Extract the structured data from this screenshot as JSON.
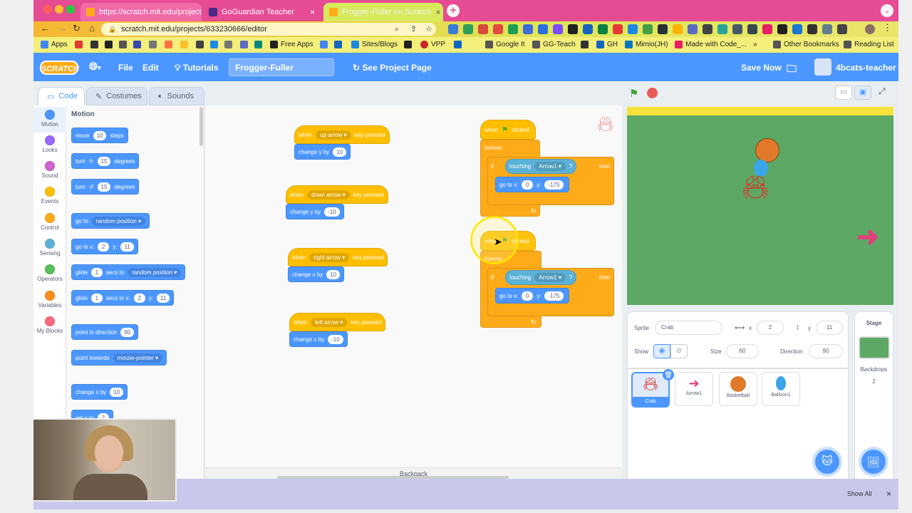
{
  "browser": {
    "tabs": [
      {
        "label": "https://scratch.mit.edu/projects",
        "close": "×"
      },
      {
        "label": "GoGuardian Teacher",
        "close": "×"
      },
      {
        "label": "Frogger-Fuller on Scratch",
        "close": "×"
      }
    ],
    "url": "scratch.mit.edu/projects/633230666/editor",
    "bookmarks": [
      "Apps",
      "Free Apps",
      "Sites/Blogs",
      "VPP",
      "Google It",
      "GG-Teach",
      "GH",
      "Mimio(JH)",
      "Made with Code_...",
      "Other Bookmarks",
      "Reading List"
    ]
  },
  "menubar": {
    "logo": "SCRATCH",
    "file": "File",
    "edit": "Edit",
    "tutorials": "Tutorials",
    "project_title": "Frogger-Fuller",
    "see_project": "See Project Page",
    "save": "Save Now",
    "username": "4bcats-teacher"
  },
  "editor_tabs": {
    "code": "Code",
    "costumes": "Costumes",
    "sounds": "Sounds"
  },
  "categories": [
    {
      "label": "Motion",
      "color": "#4c97ff"
    },
    {
      "label": "Looks",
      "color": "#9966ff"
    },
    {
      "label": "Sound",
      "color": "#cf63cf"
    },
    {
      "label": "Events",
      "color": "#ffbf00"
    },
    {
      "label": "Control",
      "color": "#ffab19"
    },
    {
      "label": "Sensing",
      "color": "#5cb1d6"
    },
    {
      "label": "Operators",
      "color": "#59c059"
    },
    {
      "label": "Variables",
      "color": "#ff8c1a"
    },
    {
      "label": "My Blocks",
      "color": "#ff6680"
    }
  ],
  "palette": {
    "heading": "Motion",
    "move": {
      "label": "move",
      "value": "10",
      "suffix": "steps"
    },
    "turn_right": {
      "label": "turn",
      "value": "15",
      "suffix": "degrees"
    },
    "turn_left": {
      "label": "turn",
      "value": "15",
      "suffix": "degrees"
    },
    "goto": {
      "label": "go to",
      "option": "random position"
    },
    "goto_xy": {
      "label": "go to x:",
      "x": "2",
      "ylabel": "y:",
      "y": "11"
    },
    "glide_random": {
      "label": "glide",
      "value": "1",
      "mid": "secs to",
      "option": "random position"
    },
    "glide_xy": {
      "label": "glide",
      "value": "1",
      "mid": "secs to x:",
      "x": "2",
      "ylabel": "y:",
      "y": "11"
    },
    "point_dir": {
      "label": "point in direction",
      "value": "90"
    },
    "point_towards": {
      "label": "point towards",
      "option": "mouse-pointer"
    },
    "change_x": {
      "label": "change x by",
      "value": "10"
    },
    "set_x": {
      "label": "set x to",
      "value": "2"
    }
  },
  "scripts": {
    "up": {
      "when": "when",
      "key": "up arrow",
      "pressed": "key pressed",
      "action": "change y by",
      "value": "10"
    },
    "down": {
      "when": "when",
      "key": "down arrow",
      "pressed": "key pressed",
      "action": "change y by",
      "value": "-10"
    },
    "right": {
      "when": "when",
      "key": "right arrow",
      "pressed": "key pressed",
      "action": "change x by",
      "value": "10"
    },
    "left": {
      "when": "when",
      "key": "left arrow",
      "pressed": "key pressed",
      "action": "change x by",
      "value": "-10"
    },
    "flag1": {
      "when": "when",
      "clicked": "clicked",
      "forever": "forever",
      "if": "if",
      "touching": "touching",
      "sprite": "Arrow1",
      "q": "?",
      "then": "then",
      "goto": "go to x:",
      "x": "0",
      "ylabel": "y:",
      "y": "-175"
    },
    "flag2": {
      "when": "when",
      "clicked": "clicked",
      "forever": "forever",
      "if": "if",
      "touching": "touching",
      "sprite": "Arrow1",
      "q": "?",
      "then": "then",
      "goto": "go to x:",
      "x": "0",
      "ylabel": "y:",
      "y": "-175"
    }
  },
  "workspace": {
    "backpack": "Backpack"
  },
  "sprite_info": {
    "sprite_label": "Sprite",
    "sprite_name": "Crab",
    "x_label": "x",
    "x": "2",
    "y_label": "y",
    "y": "11",
    "show_label": "Show",
    "size_label": "Size",
    "size": "60",
    "direction_label": "Direction",
    "direction": "90"
  },
  "sprites": [
    "Crab",
    "Arrow1",
    "Basketball",
    "Balloon1"
  ],
  "stage_panel": {
    "title": "Stage",
    "backdrops_label": "Backdrops",
    "backdrops": "2"
  },
  "notification": {
    "show_all": "Show All",
    "close": "×"
  }
}
